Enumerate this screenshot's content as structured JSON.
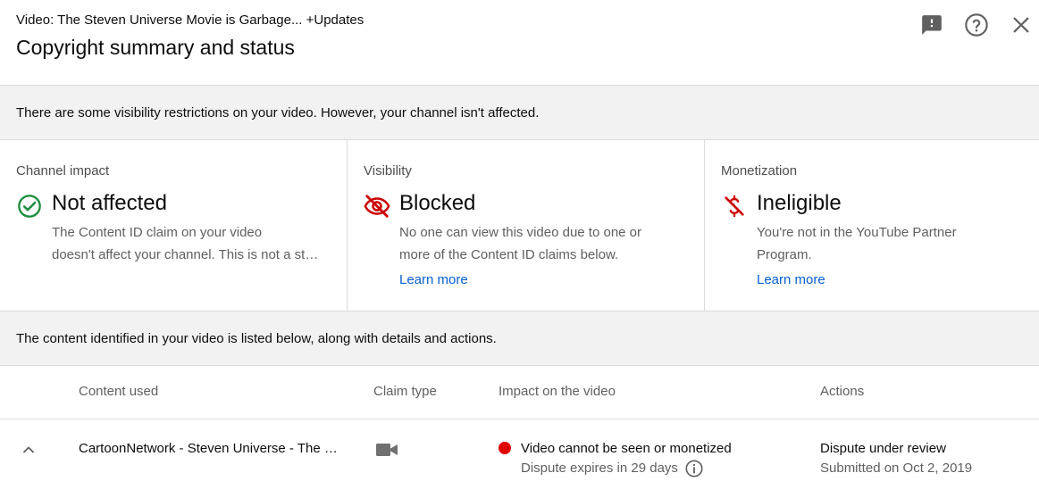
{
  "header": {
    "video_title": "Video: The Steven Universe Movie is Garbage... +Updates",
    "page_title": "Copyright summary and status",
    "icons": [
      "feedback-icon",
      "help-icon",
      "close-icon"
    ]
  },
  "summary_banner": "There are some visibility restrictions on your video. However, your channel isn't affected.",
  "cards": {
    "channel_impact": {
      "label": "Channel impact",
      "status": "Not affected",
      "status_color": "#1e8e3e",
      "desc_line1": "The Content ID claim on your video",
      "desc_line2": "doesn't affect your channel. This is not a strike against your channel."
    },
    "visibility": {
      "label": "Visibility",
      "status": "Blocked",
      "status_color": "#cc0000",
      "desc_line1": "No one can view this video due to one or",
      "desc_line2": "more of the Content ID claims below.",
      "link": "Learn more"
    },
    "monetization": {
      "label": "Monetization",
      "status": "Ineligible",
      "status_color": "#cc0000",
      "desc_line1": "You're not in the YouTube Partner",
      "desc_line2": "Program.",
      "link": "Learn more"
    }
  },
  "content_banner": "The content identified in your video is listed below, along with details and actions.",
  "table": {
    "columns": [
      "Content used",
      "Claim type",
      "Impact on the video",
      "Actions"
    ],
    "rows": [
      {
        "content_used": "CartoonNetwork - Steven Universe - The Movie",
        "claim_type_icon": "video-camera-icon",
        "impact_main": "Video cannot be seen or monetized",
        "impact_sub": "Dispute expires in 29 days",
        "action_main": "Dispute under review",
        "action_sub": "Submitted on Oct 2, 2019"
      }
    ]
  }
}
